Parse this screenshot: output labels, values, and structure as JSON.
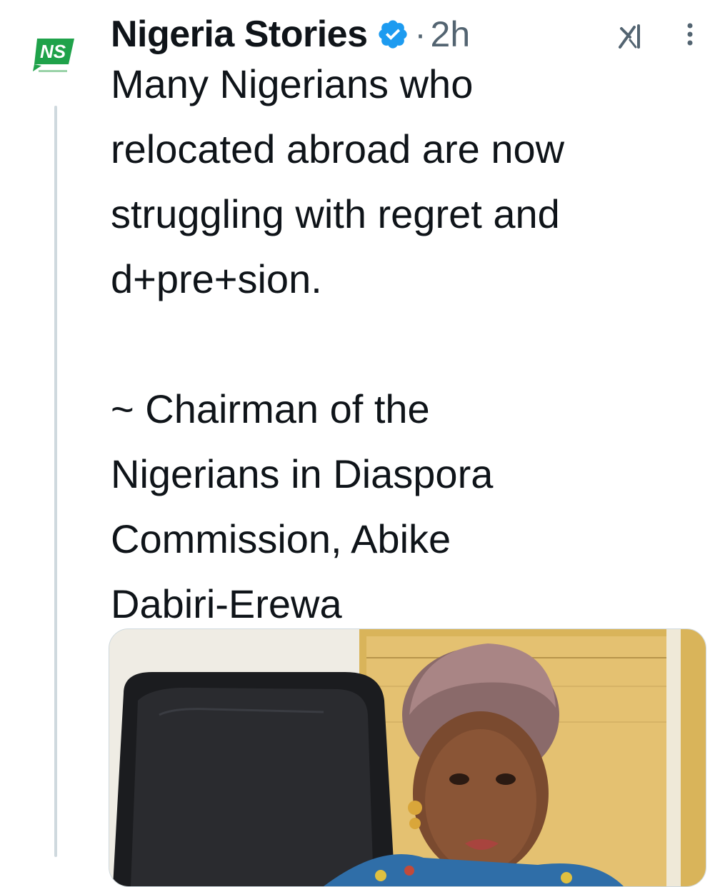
{
  "tweet": {
    "author_name": "Nigeria Stories",
    "separator": "·",
    "timestamp": "2h",
    "text": "Many Nigerians who\nrelocated abroad are now\nstruggling with regret and\nd+pre+sion.\n\n~ Chairman of the\nNigerians in Diaspora\nCommission, Abike\nDabiri-Erewa"
  },
  "avatar": {
    "logo_text": "NS"
  },
  "icons": {
    "verified": "verified-badge-icon",
    "grok": "grok-icon",
    "more": "more-options-icon"
  },
  "colors": {
    "verified_blue": "#1d9bf0",
    "logo_green": "#1fa24a",
    "text_primary": "#0f1419",
    "text_secondary": "#536471",
    "thread_line": "#cfd9de"
  }
}
